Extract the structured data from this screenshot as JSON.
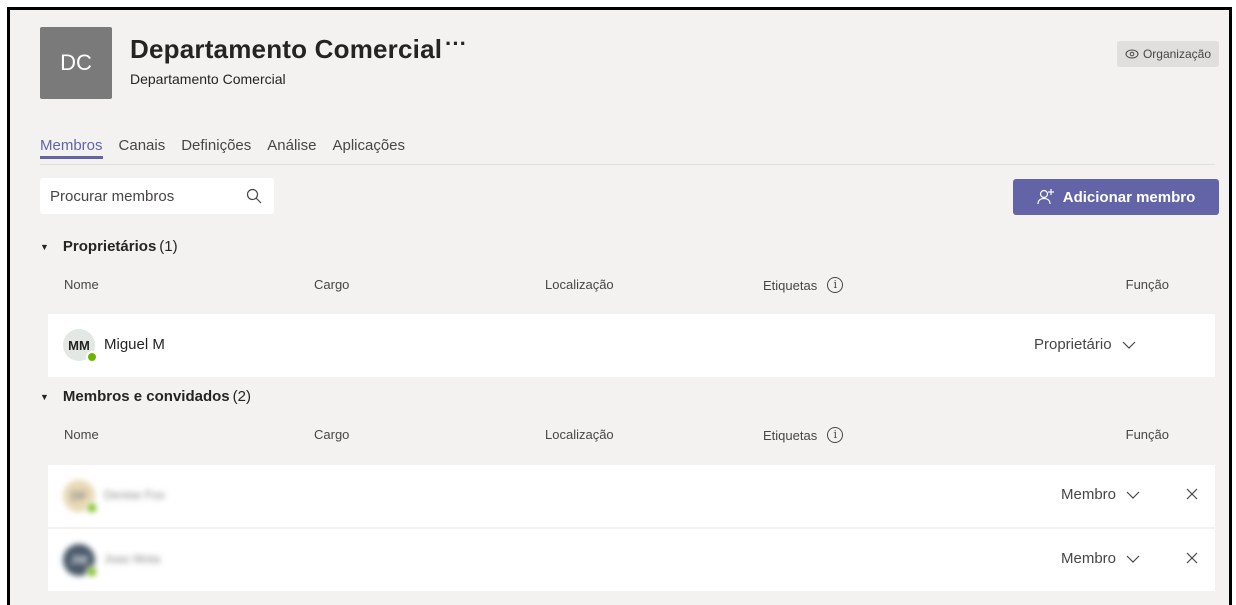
{
  "team": {
    "avatar_initials": "DC",
    "title": "Departamento Comercial",
    "more": "···",
    "subtitle": "Departamento Comercial",
    "org_badge": "Organização",
    "org_icon": "eye-icon"
  },
  "tabs": [
    {
      "label": "Membros",
      "active": true
    },
    {
      "label": "Canais",
      "active": false
    },
    {
      "label": "Definições",
      "active": false
    },
    {
      "label": "Análise",
      "active": false
    },
    {
      "label": "Aplicações",
      "active": false
    }
  ],
  "search": {
    "placeholder": "Procurar membros"
  },
  "add_member_button": "Adicionar membro",
  "columns": {
    "name": "Nome",
    "role_title": "Cargo",
    "location": "Localização",
    "tags": "Etiquetas",
    "function": "Função"
  },
  "owners": {
    "title": "Proprietários",
    "count": "(1)",
    "rows": [
      {
        "initials": "MM",
        "name": "Miguel M",
        "role": "Proprietário"
      }
    ]
  },
  "members": {
    "title": "Membros e convidados",
    "count": "(2)",
    "rows": [
      {
        "initials": "DF",
        "name": "Denise Fox",
        "role": "Membro"
      },
      {
        "initials": "JW",
        "name": "Joao Mota",
        "role": "Membro"
      }
    ]
  },
  "colors": {
    "accent": "#6264a7",
    "background": "#f3f2f1",
    "presence": "#6bb700"
  }
}
